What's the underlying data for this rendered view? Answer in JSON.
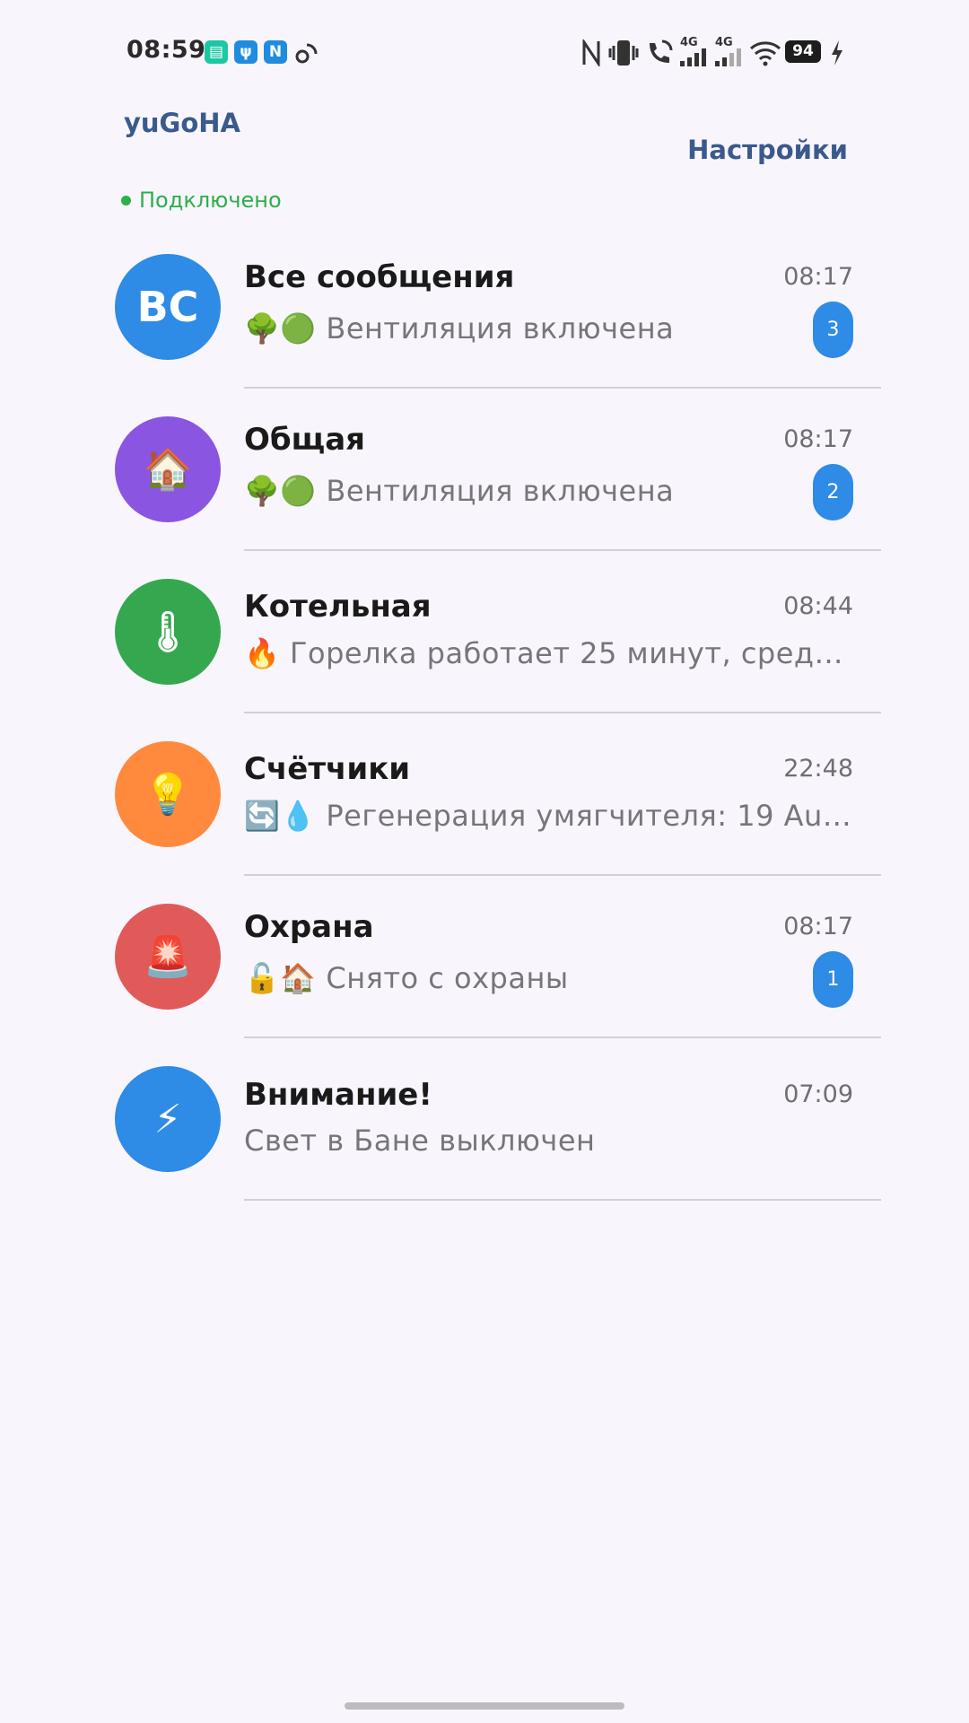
{
  "status_bar": {
    "time": "08:59",
    "battery": "94",
    "notif_icons": [
      {
        "name": "chat-notif-icon",
        "glyph": "▤",
        "color": "#1CC8A3"
      },
      {
        "name": "usb-notif-icon",
        "glyph": "ψ",
        "color": "#1F8CE0"
      },
      {
        "name": "nfc-notif-icon",
        "glyph": "N",
        "color": "#1F8CE0"
      }
    ],
    "network_labels": [
      "4G",
      "4G"
    ]
  },
  "header": {
    "title": "yuGoHA",
    "settings_label": "Настройки",
    "connection_status": "Подключено",
    "connection_color": "#2BB04A"
  },
  "chats": [
    {
      "name": "Все сообщения",
      "time": "08:17",
      "preview": "🌳🟢 Вентиляция включена",
      "badge": "3",
      "avatar_text": "ВС",
      "avatar_color": "#2E8BE6",
      "icon": "text-initials"
    },
    {
      "name": "Общая",
      "time": "08:17",
      "preview": "🌳🟢 Вентиляция включена",
      "badge": "2",
      "avatar_text": "🏠",
      "avatar_color": "#8A55E0",
      "icon": "house-icon"
    },
    {
      "name": "Котельная",
      "time": "08:44",
      "preview": "🔥 Горелка работает 25 минут, средн…",
      "badge": "",
      "avatar_text": "🌡",
      "avatar_color": "#35A84F",
      "icon": "thermometer-icon"
    },
    {
      "name": "Счётчики",
      "time": "22:48",
      "preview": "🔄💧 Регенерация умягчителя: 19 Au…",
      "badge": "",
      "avatar_text": "💡",
      "avatar_color": "#FF8A3D",
      "icon": "lightbulb-icon"
    },
    {
      "name": "Охрана",
      "time": "08:17",
      "preview": "🔓🏠 Снято с охраны",
      "badge": "1",
      "avatar_text": "🚨",
      "avatar_color": "#E05A5A",
      "icon": "siren-icon"
    },
    {
      "name": "Внимание!",
      "time": "07:09",
      "preview": "Свет в Бане выключен",
      "badge": "",
      "avatar_text": "⚡",
      "avatar_color": "#2E8BE6",
      "icon": "lightning-icon"
    }
  ]
}
